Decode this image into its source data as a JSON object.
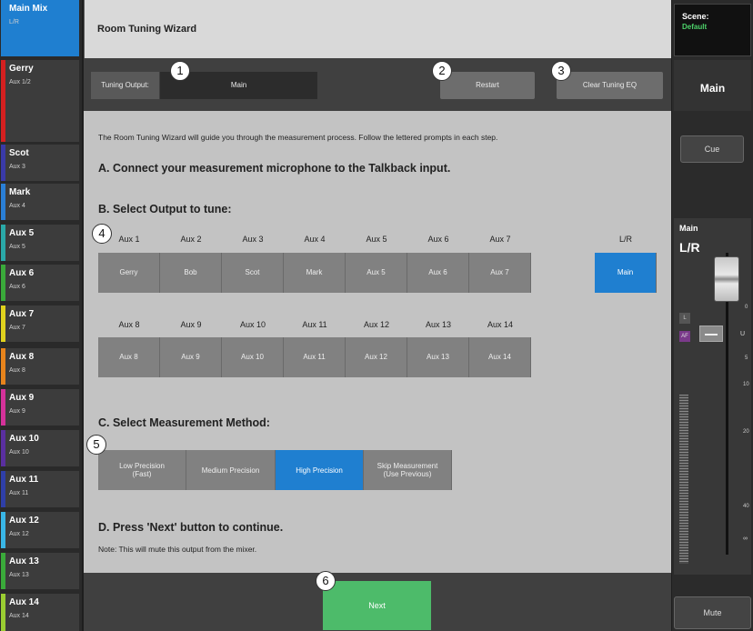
{
  "sidebar": {
    "channels": [
      {
        "name": "Main Mix",
        "sub": "L/R",
        "color": "#1f7fd0"
      },
      {
        "name": "Gerry",
        "sub": "Aux 1/2",
        "color": "#d42020"
      },
      {
        "name": "Scot",
        "sub": "Aux 3",
        "color": "#3a3aa8"
      },
      {
        "name": "Mark",
        "sub": "Aux 4",
        "color": "#2a7fd6"
      },
      {
        "name": "Aux 5",
        "sub": "Aux 5",
        "color": "#2aa9a8"
      },
      {
        "name": "Aux 6",
        "sub": "Aux 6",
        "color": "#3aaa3a"
      },
      {
        "name": "Aux 7",
        "sub": "Aux 7",
        "color": "#e0d21e"
      },
      {
        "name": "Aux 8",
        "sub": "Aux 8",
        "color": "#e8841c"
      },
      {
        "name": "Aux 9",
        "sub": "Aux 9",
        "color": "#d4329a"
      },
      {
        "name": "Aux 10",
        "sub": "Aux 10",
        "color": "#5a2fa0"
      },
      {
        "name": "Aux 11",
        "sub": "Aux 11",
        "color": "#2f3fa8"
      },
      {
        "name": "Aux 12",
        "sub": "Aux 12",
        "color": "#39b6e6"
      },
      {
        "name": "Aux 13",
        "sub": "Aux 13",
        "color": "#3aaa3a"
      },
      {
        "name": "Aux 14",
        "sub": "Aux 14",
        "color": "#9acd32"
      }
    ]
  },
  "header": {
    "title": "Room Tuning Wizard"
  },
  "right_panel": {
    "scene_label": "Scene:",
    "scene_value": "Default",
    "output_name": "Main",
    "cue_label": "Cue",
    "fader_title": "Main",
    "fader_sub": "L/R",
    "mute_label": "Mute",
    "scale": [
      "0",
      "5",
      "10",
      "20",
      "40",
      "∞"
    ],
    "l_tag": "L",
    "af_tag": "AF",
    "u_tag": "U"
  },
  "toolbar": {
    "tuning_output_label": "Tuning Output:",
    "tuning_output_value": "Main",
    "restart_label": "Restart",
    "clear_label": "Clear Tuning EQ"
  },
  "content": {
    "intro": "The Room Tuning Wizard will guide you through the measurement process. Follow the lettered prompts in each step.",
    "step_a": "A. Connect your measurement microphone to the Talkback input.",
    "step_b": "B. Select Output to tune:",
    "outputs_row1": [
      {
        "header": "Aux 1",
        "label": "Gerry"
      },
      {
        "header": "Aux 2",
        "label": "Bob"
      },
      {
        "header": "Aux 3",
        "label": "Scot"
      },
      {
        "header": "Aux 4",
        "label": "Mark"
      },
      {
        "header": "Aux 5",
        "label": "Aux 5"
      },
      {
        "header": "Aux 6",
        "label": "Aux 6"
      },
      {
        "header": "Aux 7",
        "label": "Aux 7"
      }
    ],
    "lr": {
      "header": "L/R",
      "label": "Main",
      "selected": true
    },
    "outputs_row2": [
      {
        "header": "Aux 8",
        "label": "Aux 8"
      },
      {
        "header": "Aux 9",
        "label": "Aux 9"
      },
      {
        "header": "Aux 10",
        "label": "Aux 10"
      },
      {
        "header": "Aux 11",
        "label": "Aux 11"
      },
      {
        "header": "Aux 12",
        "label": "Aux 12"
      },
      {
        "header": "Aux 13",
        "label": "Aux 13"
      },
      {
        "header": "Aux 14",
        "label": "Aux 14"
      }
    ],
    "step_c": "C. Select Measurement Method:",
    "methods": [
      {
        "label": "Low Precision\n(Fast)",
        "selected": false
      },
      {
        "label": "Medium Precision",
        "selected": false
      },
      {
        "label": "High Precision",
        "selected": true
      },
      {
        "label": "Skip Measurement\n(Use Previous)",
        "selected": false
      }
    ],
    "step_d": "D. Press 'Next' button to continue.",
    "note": "Note: This will mute this output from the mixer."
  },
  "footer": {
    "next_label": "Next"
  },
  "callouts": [
    "1",
    "2",
    "3",
    "4",
    "5",
    "6"
  ],
  "colors": {
    "accent": "#1f7fd0",
    "next": "#4dbb6a"
  }
}
